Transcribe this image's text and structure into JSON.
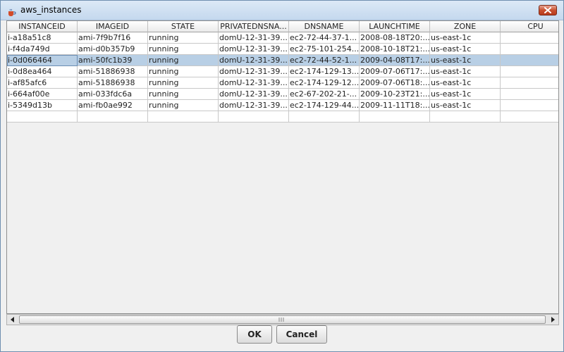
{
  "window": {
    "title": "aws_instances"
  },
  "table": {
    "columns": [
      "INSTANCEID",
      "IMAGEID",
      "STATE",
      "PRIVATEDNSNA...",
      "DNSNAME",
      "LAUNCHTIME",
      "ZONE",
      "CPU"
    ],
    "rows": [
      [
        "i-a18a51c8",
        "ami-7f9b7f16",
        "running",
        "domU-12-31-39...",
        "ec2-72-44-37-1...",
        "2008-08-18T20:...",
        "us-east-1c",
        ""
      ],
      [
        "i-f4da749d",
        "ami-d0b357b9",
        "running",
        "domU-12-31-39...",
        "ec2-75-101-254...",
        "2008-10-18T21:...",
        "us-east-1c",
        ""
      ],
      [
        "i-0d066464",
        "ami-50fc1b39",
        "running",
        "domU-12-31-39...",
        "ec2-72-44-52-1...",
        "2009-04-08T17:...",
        "us-east-1c",
        ""
      ],
      [
        "i-0d8ea464",
        "ami-51886938",
        "running",
        "domU-12-31-39...",
        "ec2-174-129-13...",
        "2009-07-06T17:...",
        "us-east-1c",
        ""
      ],
      [
        "i-af85afc6",
        "ami-51886938",
        "running",
        "domU-12-31-39...",
        "ec2-174-129-12...",
        "2009-07-06T18:...",
        "us-east-1c",
        ""
      ],
      [
        "i-664af00e",
        "ami-033fdc6a",
        "running",
        "domU-12-31-39...",
        "ec2-67-202-21-...",
        "2009-10-23T21:...",
        "us-east-1c",
        ""
      ],
      [
        "i-5349d13b",
        "ami-fb0ae992",
        "running",
        "domU-12-31-39...",
        "ec2-174-129-44...",
        "2009-11-11T18:...",
        "us-east-1c",
        ""
      ],
      [
        "",
        "",
        "",
        "",
        "",
        "",
        "",
        ""
      ]
    ],
    "selected_row": 2
  },
  "buttons": {
    "ok_label": "OK",
    "cancel_label": "Cancel"
  },
  "icons": {
    "app": "java-coffee-icon",
    "close": "close-icon",
    "scroll_left": "arrow-left-icon",
    "scroll_right": "arrow-right-icon"
  },
  "colors": {
    "selection": "#b8cfe5",
    "close_button": "#c8502f"
  }
}
